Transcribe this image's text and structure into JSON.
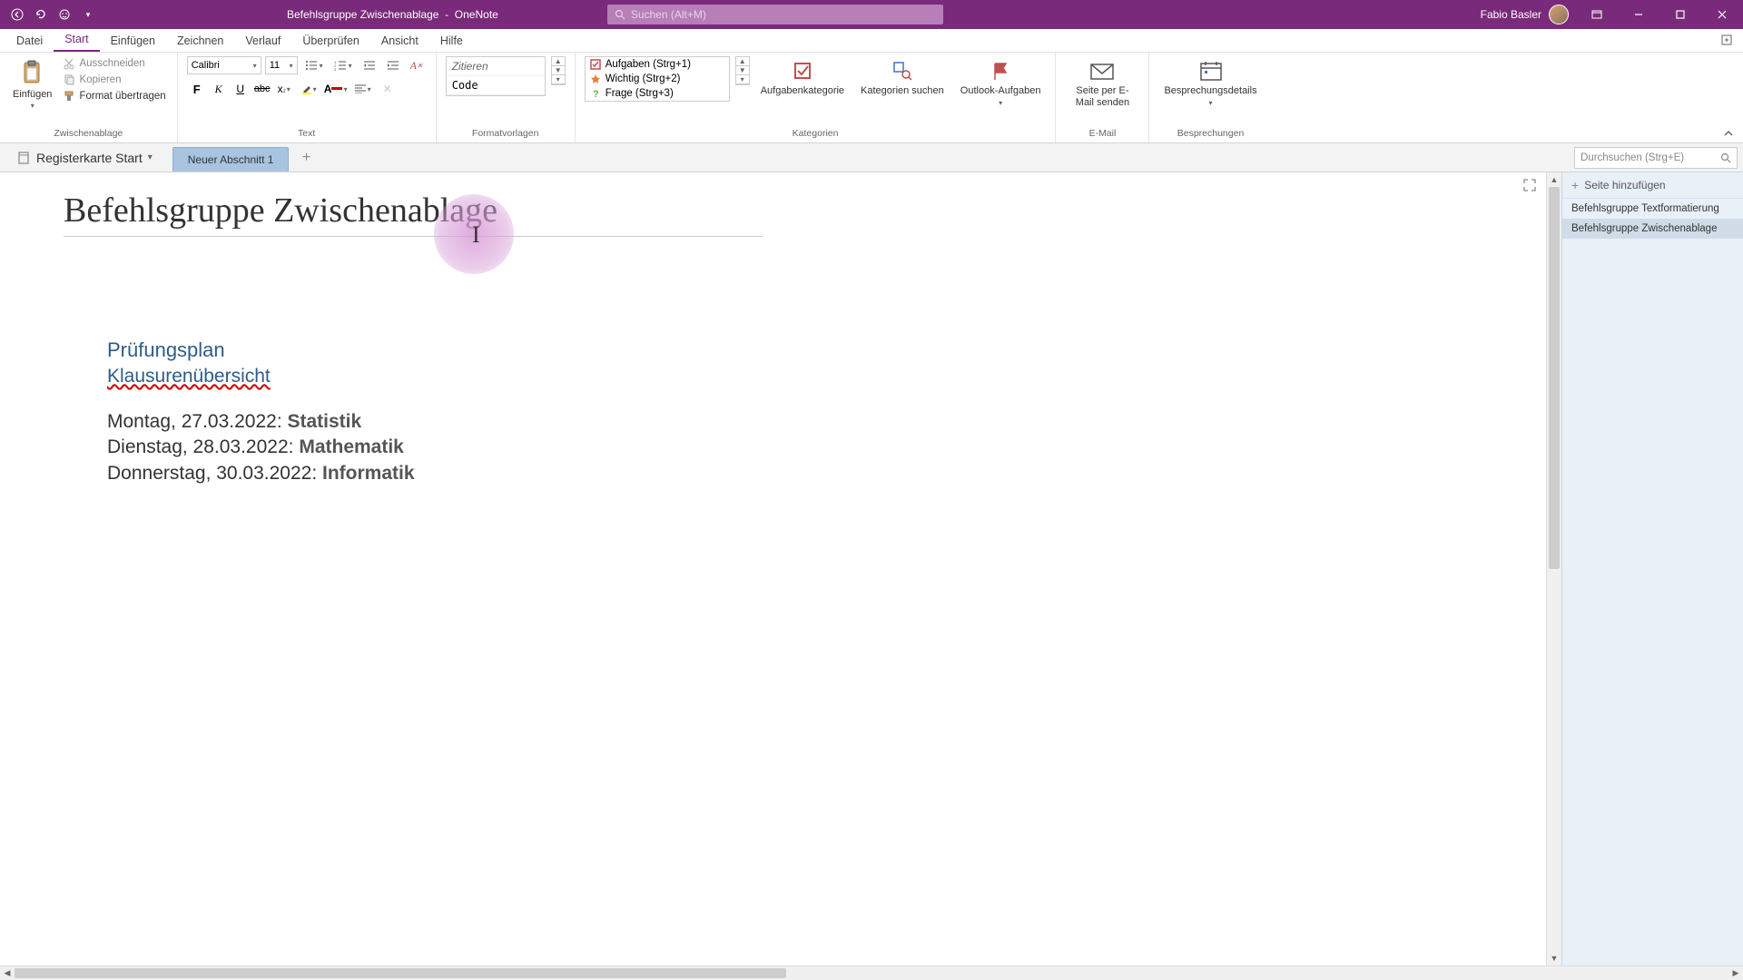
{
  "titlebar": {
    "doc_title": "Befehlsgruppe Zwischenablage",
    "app_name": "OneNote",
    "search_placeholder": "Suchen (Alt+M)",
    "user_name": "Fabio Basler"
  },
  "menu": {
    "tabs": [
      "Datei",
      "Start",
      "Einfügen",
      "Zeichnen",
      "Verlauf",
      "Überprüfen",
      "Ansicht",
      "Hilfe"
    ],
    "active_index": 1
  },
  "ribbon": {
    "clipboard": {
      "paste": "Einfügen",
      "cut": "Ausschneiden",
      "copy": "Kopieren",
      "format_painter": "Format übertragen",
      "group_label": "Zwischenablage"
    },
    "text": {
      "font_name": "Calibri",
      "font_size": "11",
      "group_label": "Text"
    },
    "styles": {
      "items": [
        "Zitieren",
        "Code"
      ],
      "group_label": "Formatvorlagen"
    },
    "tags": {
      "items": [
        {
          "label": "Aufgaben (Strg+1)",
          "icon": "checkbox"
        },
        {
          "label": "Wichtig (Strg+2)",
          "icon": "star"
        },
        {
          "label": "Frage (Strg+3)",
          "icon": "question"
        }
      ],
      "task_cat": "Aufgabenkategorie",
      "find_tags": "Kategorien suchen",
      "outlook": "Outlook-Aufgaben",
      "group_label": "Kategorien"
    },
    "email": {
      "btn": "Seite per E-Mail senden",
      "group_label": "E-Mail"
    },
    "meetings": {
      "btn": "Besprechungsdetails",
      "group_label": "Besprechungen"
    }
  },
  "notebook": {
    "dropdown": "Registerkarte Start",
    "section_tab": "Neuer Abschnitt 1",
    "page_search_placeholder": "Durchsuchen (Strg+E)"
  },
  "page": {
    "title": "Befehlsgruppe Zwischenablage",
    "body": {
      "heading1": "Prüfungsplan",
      "heading2": "Klausurenübersicht",
      "rows": [
        {
          "prefix": "Montag, 27.03.2022: ",
          "bold": "Statistik"
        },
        {
          "prefix": "Dienstag, 28.03.2022: ",
          "bold": "Mathematik"
        },
        {
          "prefix": "Donnerstag, 30.03.2022: ",
          "bold": "Informatik"
        }
      ]
    }
  },
  "pagelist": {
    "add_label": "Seite hinzufügen",
    "items": [
      "Befehlsgruppe Textformatierung",
      "Befehlsgruppe Zwischenablage"
    ],
    "selected_index": 1
  }
}
